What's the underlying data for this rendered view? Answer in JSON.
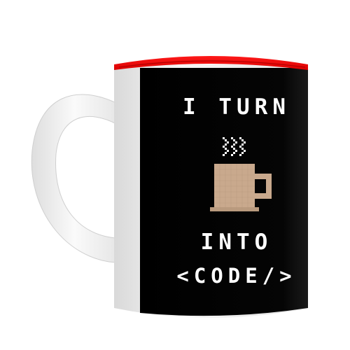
{
  "product": {
    "print": {
      "line1": "I TURN",
      "line2": "INTO",
      "line3": "<CODE/>"
    },
    "icons": [
      "steam-icon",
      "coffee-cup-icon"
    ],
    "colors": {
      "interior": "#e30613",
      "print_background": "#000000",
      "print_text": "#ffffff",
      "body": "#f2f2f2",
      "cup": "#c9a98d",
      "steam": "#ffffff"
    }
  }
}
